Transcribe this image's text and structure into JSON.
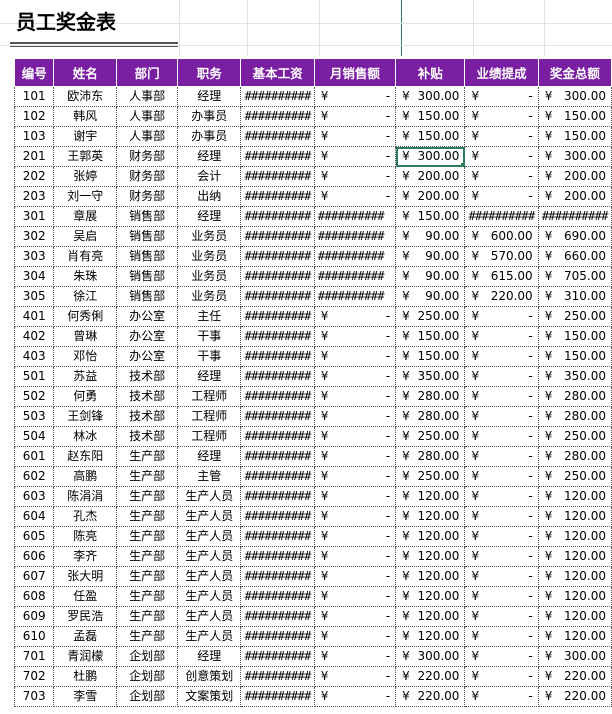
{
  "title": "员工奖金表",
  "headers": [
    "编号",
    "姓名",
    "部门",
    "职务",
    "基本工资",
    "月销售额",
    "补贴",
    "业绩提成",
    "奖金总额"
  ],
  "overflow_text": "##########",
  "currency_symbol": "¥",
  "dash": "-",
  "selected_cell": {
    "row": 3,
    "column": "补贴"
  },
  "colors": {
    "header_bg": "#7b1fa2",
    "header_text": "#ffffff",
    "selection": "#2e7d5b"
  },
  "rows": [
    {
      "id": "101",
      "name": "欧沛东",
      "dept": "人事部",
      "role": "经理",
      "base": "#",
      "sales": "-",
      "allow": "300.00",
      "comm": "-",
      "total": "300.00"
    },
    {
      "id": "102",
      "name": "韩风",
      "dept": "人事部",
      "role": "办事员",
      "base": "#",
      "sales": "-",
      "allow": "150.00",
      "comm": "-",
      "total": "150.00"
    },
    {
      "id": "103",
      "name": "谢宇",
      "dept": "人事部",
      "role": "办事员",
      "base": "#",
      "sales": "-",
      "allow": "150.00",
      "comm": "-",
      "total": "150.00"
    },
    {
      "id": "201",
      "name": "王郭英",
      "dept": "财务部",
      "role": "经理",
      "base": "#",
      "sales": "-",
      "allow": "300.00",
      "comm": "-",
      "total": "300.00"
    },
    {
      "id": "202",
      "name": "张婷",
      "dept": "财务部",
      "role": "会计",
      "base": "#",
      "sales": "-",
      "allow": "200.00",
      "comm": "-",
      "total": "200.00"
    },
    {
      "id": "203",
      "name": "刘一守",
      "dept": "财务部",
      "role": "出纳",
      "base": "#",
      "sales": "-",
      "allow": "200.00",
      "comm": "-",
      "total": "200.00"
    },
    {
      "id": "301",
      "name": "章展",
      "dept": "销售部",
      "role": "经理",
      "base": "#",
      "sales": "#",
      "allow": "150.00",
      "comm": "#",
      "total": "#"
    },
    {
      "id": "302",
      "name": "吴启",
      "dept": "销售部",
      "role": "业务员",
      "base": "#",
      "sales": "#",
      "allow": "90.00",
      "comm": "600.00",
      "total": "690.00"
    },
    {
      "id": "303",
      "name": "肖有亮",
      "dept": "销售部",
      "role": "业务员",
      "base": "#",
      "sales": "#",
      "allow": "90.00",
      "comm": "570.00",
      "total": "660.00"
    },
    {
      "id": "304",
      "name": "朱珠",
      "dept": "销售部",
      "role": "业务员",
      "base": "#",
      "sales": "#",
      "allow": "90.00",
      "comm": "615.00",
      "total": "705.00"
    },
    {
      "id": "305",
      "name": "徐江",
      "dept": "销售部",
      "role": "业务员",
      "base": "#",
      "sales": "#",
      "allow": "90.00",
      "comm": "220.00",
      "total": "310.00"
    },
    {
      "id": "401",
      "name": "何秀俐",
      "dept": "办公室",
      "role": "主任",
      "base": "#",
      "sales": "-",
      "allow": "250.00",
      "comm": "-",
      "total": "250.00"
    },
    {
      "id": "402",
      "name": "曾琳",
      "dept": "办公室",
      "role": "干事",
      "base": "#",
      "sales": "-",
      "allow": "150.00",
      "comm": "-",
      "total": "150.00"
    },
    {
      "id": "403",
      "name": "邓怡",
      "dept": "办公室",
      "role": "干事",
      "base": "#",
      "sales": "-",
      "allow": "150.00",
      "comm": "-",
      "total": "150.00"
    },
    {
      "id": "501",
      "name": "苏益",
      "dept": "技术部",
      "role": "经理",
      "base": "#",
      "sales": "-",
      "allow": "350.00",
      "comm": "-",
      "total": "350.00"
    },
    {
      "id": "502",
      "name": "何勇",
      "dept": "技术部",
      "role": "工程师",
      "base": "#",
      "sales": "-",
      "allow": "280.00",
      "comm": "-",
      "total": "280.00"
    },
    {
      "id": "503",
      "name": "王剑锋",
      "dept": "技术部",
      "role": "工程师",
      "base": "#",
      "sales": "-",
      "allow": "280.00",
      "comm": "-",
      "total": "280.00"
    },
    {
      "id": "504",
      "name": "林冰",
      "dept": "技术部",
      "role": "工程师",
      "base": "#",
      "sales": "-",
      "allow": "250.00",
      "comm": "-",
      "total": "250.00"
    },
    {
      "id": "601",
      "name": "赵东阳",
      "dept": "生产部",
      "role": "经理",
      "base": "#",
      "sales": "-",
      "allow": "280.00",
      "comm": "-",
      "total": "280.00"
    },
    {
      "id": "602",
      "name": "高鹏",
      "dept": "生产部",
      "role": "主管",
      "base": "#",
      "sales": "-",
      "allow": "250.00",
      "comm": "-",
      "total": "250.00"
    },
    {
      "id": "603",
      "name": "陈涓涓",
      "dept": "生产部",
      "role": "生产人员",
      "base": "#",
      "sales": "-",
      "allow": "120.00",
      "comm": "-",
      "total": "120.00"
    },
    {
      "id": "604",
      "name": "孔杰",
      "dept": "生产部",
      "role": "生产人员",
      "base": "#",
      "sales": "-",
      "allow": "120.00",
      "comm": "-",
      "total": "120.00"
    },
    {
      "id": "605",
      "name": "陈亮",
      "dept": "生产部",
      "role": "生产人员",
      "base": "#",
      "sales": "-",
      "allow": "120.00",
      "comm": "-",
      "total": "120.00"
    },
    {
      "id": "606",
      "name": "李齐",
      "dept": "生产部",
      "role": "生产人员",
      "base": "#",
      "sales": "-",
      "allow": "120.00",
      "comm": "-",
      "total": "120.00"
    },
    {
      "id": "607",
      "name": "张大明",
      "dept": "生产部",
      "role": "生产人员",
      "base": "#",
      "sales": "-",
      "allow": "120.00",
      "comm": "-",
      "total": "120.00"
    },
    {
      "id": "608",
      "name": "任盈",
      "dept": "生产部",
      "role": "生产人员",
      "base": "#",
      "sales": "-",
      "allow": "120.00",
      "comm": "-",
      "total": "120.00"
    },
    {
      "id": "609",
      "name": "罗民浩",
      "dept": "生产部",
      "role": "生产人员",
      "base": "#",
      "sales": "-",
      "allow": "120.00",
      "comm": "-",
      "total": "120.00"
    },
    {
      "id": "610",
      "name": "孟磊",
      "dept": "生产部",
      "role": "生产人员",
      "base": "#",
      "sales": "-",
      "allow": "120.00",
      "comm": "-",
      "total": "120.00"
    },
    {
      "id": "701",
      "name": "青润檬",
      "dept": "企划部",
      "role": "经理",
      "base": "#",
      "sales": "-",
      "allow": "300.00",
      "comm": "-",
      "total": "300.00"
    },
    {
      "id": "702",
      "name": "杜鹏",
      "dept": "企划部",
      "role": "创意策划",
      "base": "#",
      "sales": "-",
      "allow": "220.00",
      "comm": "-",
      "total": "220.00"
    },
    {
      "id": "703",
      "name": "李雪",
      "dept": "企划部",
      "role": "文案策划",
      "base": "#",
      "sales": "-",
      "allow": "220.00",
      "comm": "-",
      "total": "220.00"
    }
  ]
}
